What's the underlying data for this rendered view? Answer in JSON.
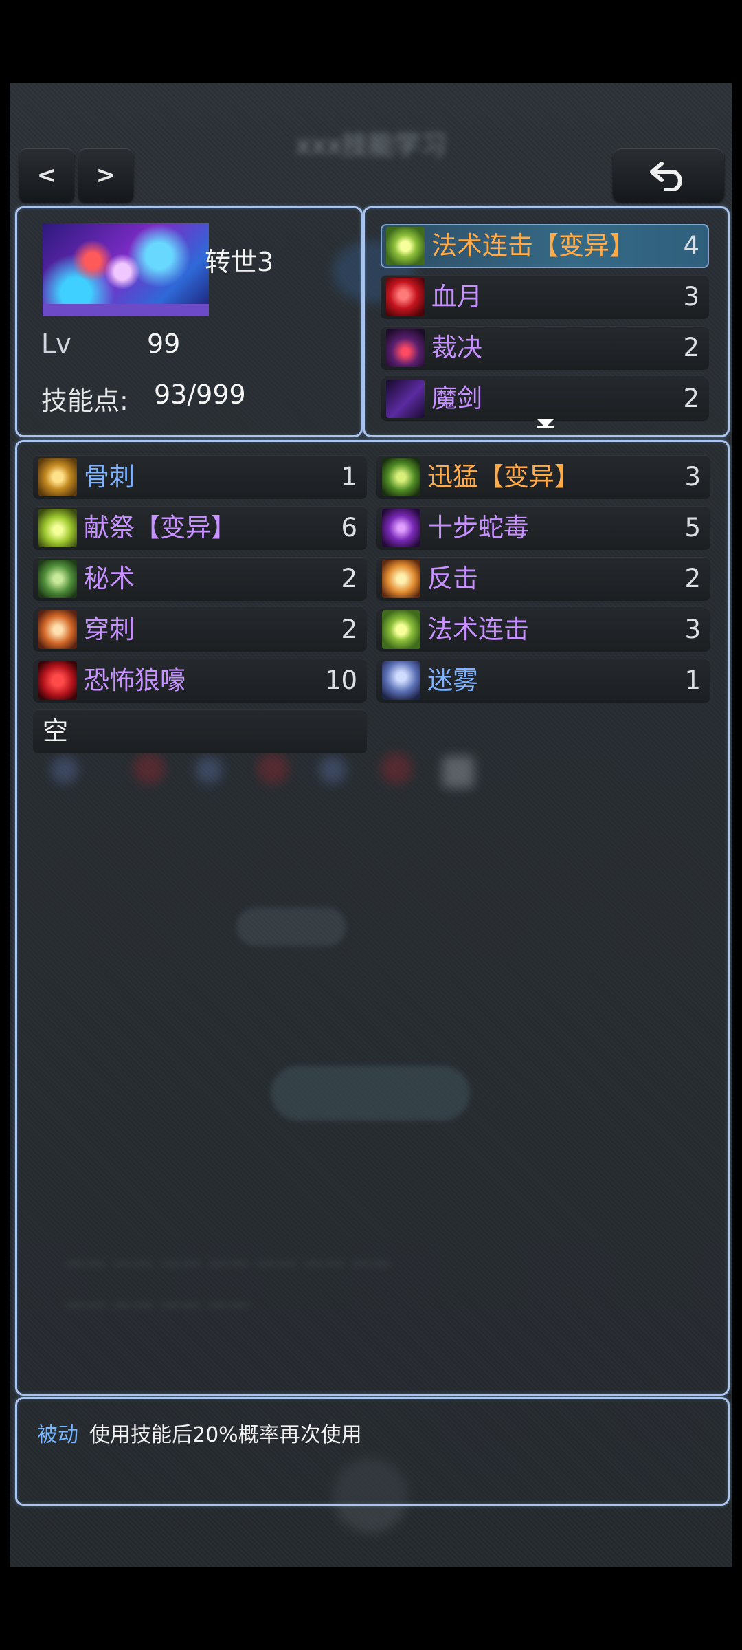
{
  "header": {
    "title_blurred": "xxx技能学习",
    "prev_label": "<",
    "next_label": ">",
    "back_icon": "undo-arrow-icon"
  },
  "character": {
    "reborn": "转世3",
    "lv_label": "Lv",
    "lv_value": "99",
    "skill_points_label": "技能点:",
    "skill_points_value": "93/999"
  },
  "equipped_skills": [
    {
      "name": "法术连击【变异】",
      "level": "4",
      "color": "orange",
      "icon": "magic-combo-icon",
      "selected": true
    },
    {
      "name": "血月",
      "level": "3",
      "color": "purple",
      "icon": "blood-moon-icon",
      "selected": false
    },
    {
      "name": "裁决",
      "level": "2",
      "color": "purple",
      "icon": "judgment-icon",
      "selected": false
    },
    {
      "name": "魔剑",
      "level": "2",
      "color": "purple",
      "icon": "demon-sword-icon",
      "selected": false
    }
  ],
  "skills_left": [
    {
      "name": "骨刺",
      "level": "1",
      "color": "blue",
      "icon": "bone-spike-icon"
    },
    {
      "name": "献祭【变异】",
      "level": "6",
      "color": "purple",
      "icon": "sacrifice-icon"
    },
    {
      "name": "秘术",
      "level": "2",
      "color": "purple",
      "icon": "arcane-icon"
    },
    {
      "name": "穿刺",
      "level": "2",
      "color": "purple",
      "icon": "pierce-icon"
    },
    {
      "name": "恐怖狼嚎",
      "level": "10",
      "color": "purple",
      "icon": "wolf-howl-icon"
    },
    {
      "name": "空",
      "level": "",
      "color": "white",
      "icon": ""
    }
  ],
  "skills_right": [
    {
      "name": "迅猛【变异】",
      "level": "3",
      "color": "orange",
      "icon": "swift-icon"
    },
    {
      "name": "十步蛇毒",
      "level": "5",
      "color": "purple",
      "icon": "snake-venom-icon"
    },
    {
      "name": "反击",
      "level": "2",
      "color": "purple",
      "icon": "counter-icon"
    },
    {
      "name": "法术连击",
      "level": "3",
      "color": "purple",
      "icon": "magic-combo-icon"
    },
    {
      "name": "迷雾",
      "level": "1",
      "color": "blue",
      "icon": "mist-icon"
    }
  ],
  "description": {
    "tag": "被动",
    "text": "使用技能后20%概率再次使用"
  },
  "colors": {
    "blue": "#7fb2ff",
    "purple": "#c792ff",
    "orange": "#ffab4a",
    "panel_border": "#a9c4ee"
  }
}
